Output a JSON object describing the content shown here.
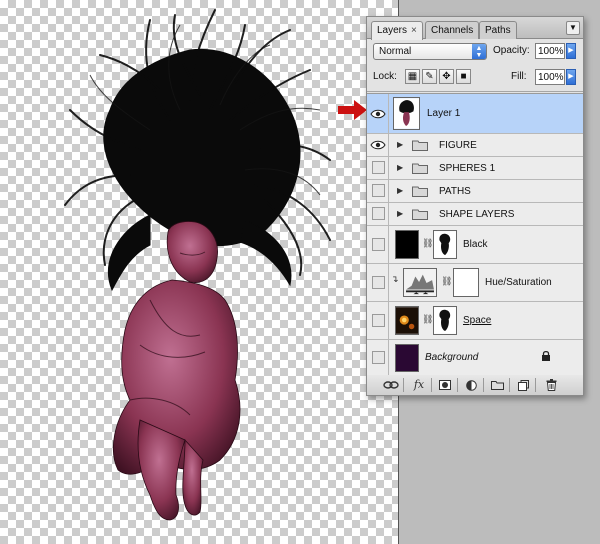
{
  "panel": {
    "tabs": [
      {
        "label": "Layers",
        "close": "×",
        "active": true
      },
      {
        "label": "Channels",
        "active": false
      },
      {
        "label": "Paths",
        "active": false
      }
    ],
    "menu_icon": "panel-menu-icon",
    "blend_mode": "Normal",
    "opacity_label": "Opacity:",
    "opacity_value": "100%",
    "lock_label": "Lock:",
    "fill_label": "Fill:",
    "fill_value": "100%"
  },
  "layers": [
    {
      "name": "Layer 1",
      "visible": true,
      "selected": true,
      "type": "pixel"
    },
    {
      "name": "FIGURE",
      "visible": true,
      "type": "group"
    },
    {
      "name": "SPHERES 1",
      "visible": false,
      "type": "group"
    },
    {
      "name": "PATHS",
      "visible": false,
      "type": "group"
    },
    {
      "name": "SHAPE LAYERS",
      "visible": false,
      "type": "group"
    },
    {
      "name": "Black",
      "visible": false,
      "type": "masked"
    },
    {
      "name": "Hue/Saturation",
      "visible": false,
      "type": "adjustment"
    },
    {
      "name": "Space",
      "visible": false,
      "type": "masked"
    },
    {
      "name": "Background",
      "visible": false,
      "type": "background",
      "locked": true
    }
  ],
  "footer_icons": [
    "link-layers-icon",
    "fx-icon",
    "add-mask-icon",
    "new-adjustment-icon",
    "new-group-icon",
    "new-layer-icon",
    "trash-icon"
  ],
  "footer_fx": "fx",
  "colors": {
    "selected_row": "#b7d3f9",
    "annotation_arrow": "#cc1111",
    "skin_tint": "#8a3452",
    "background_thumb": "#2a0833"
  }
}
